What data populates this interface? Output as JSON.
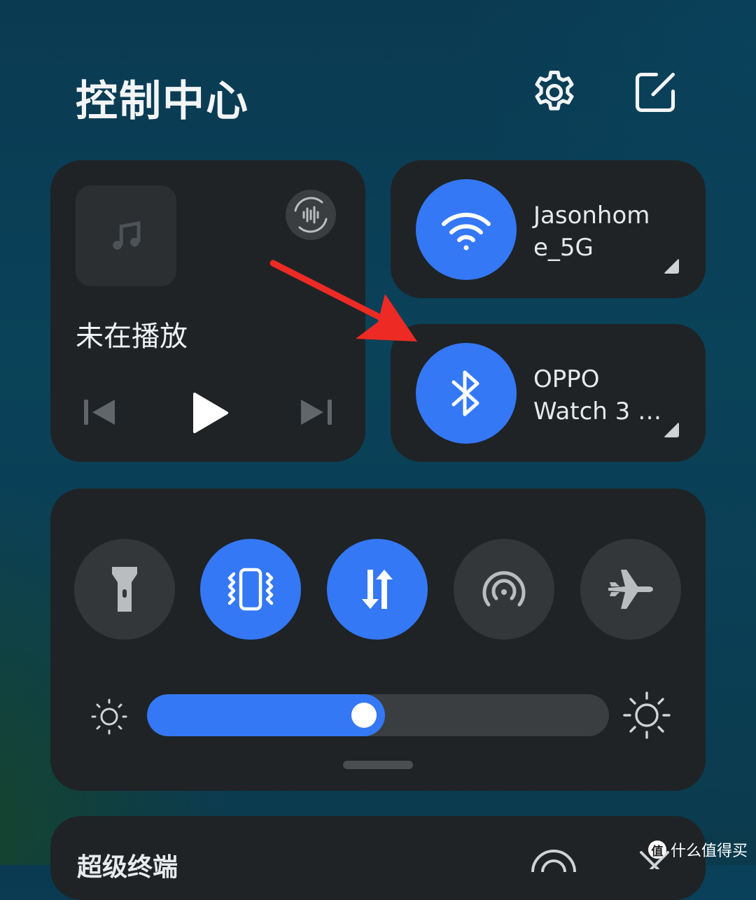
{
  "header": {
    "title": "控制中心",
    "settings_icon": "gear-icon",
    "edit_icon": "edit-icon"
  },
  "media": {
    "status": "未在播放",
    "art_icon": "music-note-icon",
    "audio_output_icon": "audio-output-icon",
    "controls": [
      "previous-icon",
      "play-icon",
      "next-icon"
    ]
  },
  "wifi": {
    "label_line1": "Jasonhom",
    "label_line2": "e_5G",
    "active": true
  },
  "bluetooth": {
    "label_line1": "OPPO",
    "label_line2": "Watch 3 …",
    "active": true
  },
  "toggles": [
    {
      "name": "flashlight",
      "icon": "flashlight-icon",
      "active": false
    },
    {
      "name": "vibrate",
      "icon": "vibrate-icon",
      "active": true
    },
    {
      "name": "mobile-data",
      "icon": "mobile-data-icon",
      "active": true
    },
    {
      "name": "hotspot",
      "icon": "hotspot-icon",
      "active": false
    },
    {
      "name": "airplane-mode",
      "icon": "airplane-icon",
      "active": false
    }
  ],
  "brightness": {
    "level": 0.515,
    "low_icon": "brightness-low-icon",
    "high_icon": "brightness-high-icon"
  },
  "bottom_card": {
    "title": "超级终端"
  },
  "watermark": {
    "badge": "值",
    "text": "什么值得买"
  },
  "colors": {
    "accent": "#3478f6",
    "card": "#1f2326",
    "inactive_toggle": "#33373a",
    "annotation_arrow": "#ee2a24"
  }
}
